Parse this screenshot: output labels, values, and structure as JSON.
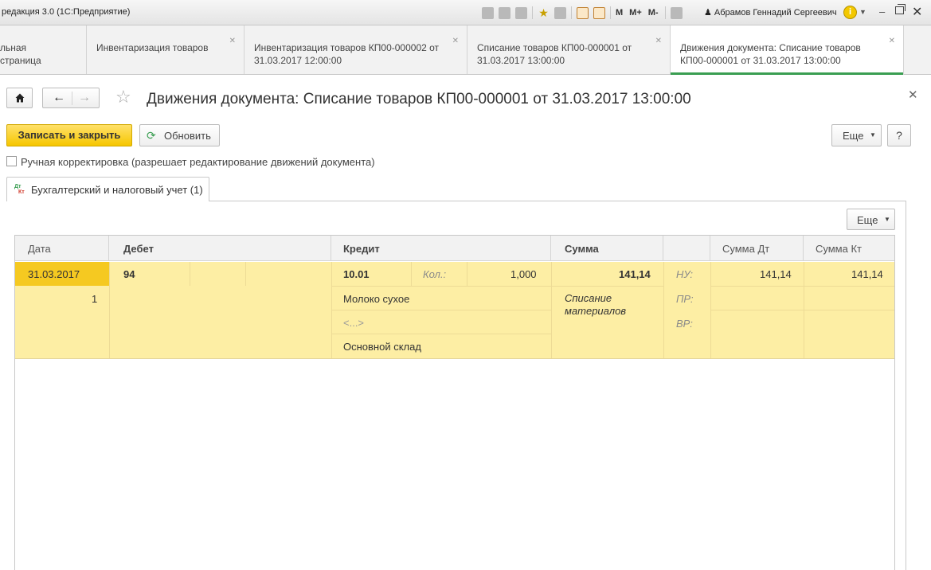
{
  "window": {
    "app_title": "редакция 3.0  (1С:Предприятие)",
    "user_name": "Абрамов Геннадий Сергеевич",
    "memory_buttons": [
      "M",
      "M+",
      "M-"
    ],
    "info_button": "i"
  },
  "tabs": [
    {
      "label": "льная страница",
      "closable": false
    },
    {
      "label": "Инвентаризация товаров",
      "closable": true
    },
    {
      "label": "Инвентаризация товаров КП00-000002 от 31.03.2017 12:00:00",
      "closable": true
    },
    {
      "label": "Списание товаров КП00-000001 от 31.03.2017 13:00:00",
      "closable": true
    },
    {
      "label": "Движения документа: Списание товаров КП00-000001 от 31.03.2017 13:00:00",
      "closable": true,
      "active": true
    }
  ],
  "form": {
    "title": "Движения документа: Списание товаров КП00-000001 от 31.03.2017 13:00:00",
    "save_close_label": "Записать и закрыть",
    "refresh_label": "Обновить",
    "more_label": "Еще",
    "help_label": "?",
    "manual_correction_label": "Ручная корректировка (разрешает редактирование движений документа)",
    "manual_correction_checked": false
  },
  "section": {
    "tab_label": "Бухгалтерский и налоговый учет (1)",
    "icon_dt": "Дт",
    "icon_kt": "Кт",
    "more_label": "Еще"
  },
  "grid": {
    "columns": [
      "Дата",
      "Дебет",
      "Кредит",
      "Сумма",
      "",
      "Сумма Дт",
      "Сумма Кт"
    ],
    "rows": [
      {
        "date": "31.03.2017",
        "line_number": "1",
        "debit_account": "94",
        "credit_account": "10.01",
        "qty_label": "Кол.:",
        "qty_value": "1,000",
        "credit_subconto1": "Молоко сухое",
        "credit_subconto2": "<...>",
        "credit_subconto3": "Основной склад",
        "amount": "141,14",
        "content": "Списание материалов",
        "nu_label": "НУ:",
        "pr_label": "ПР:",
        "vr_label": "ВР:",
        "sum_dt_nu": "141,14",
        "sum_kt_nu": "141,14"
      }
    ]
  },
  "colors": {
    "accent_green": "#3a9e52",
    "primary_button": "#f6c600",
    "row_highlight": "#fdeea4",
    "date_cell": "#f5c921"
  }
}
